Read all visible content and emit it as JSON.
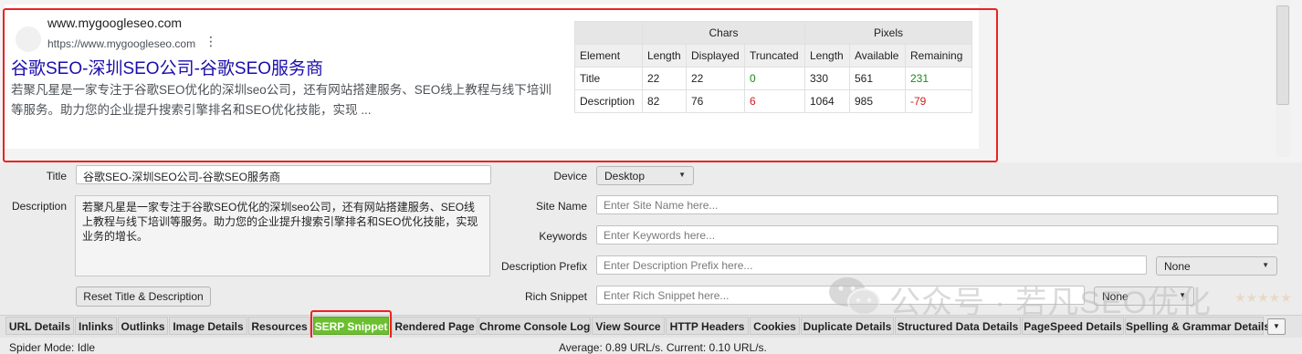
{
  "preview": {
    "site_name": "www.mygoogleseo.com",
    "site_url": "https://www.mygoogleseo.com",
    "kebab": "⋮",
    "title": "谷歌SEO-深圳SEO公司-谷歌SEO服务商",
    "description": "若聚凡星是一家专注于谷歌SEO优化的深圳seo公司，还有网站搭建服务、SEO线上教程与线下培训等服务。助力您的企业提升搜索引擎排名和SEO优化技能，实现 ..."
  },
  "stats": {
    "group_chars": "Chars",
    "group_pixels": "Pixels",
    "headers": [
      "Element",
      "Length",
      "Displayed",
      "Truncated",
      "Length",
      "Available",
      "Remaining"
    ],
    "rows": [
      {
        "element": "Title",
        "chars_length": "22",
        "displayed": "22",
        "truncated": "0",
        "px_length": "330",
        "available": "561",
        "remaining": "231"
      },
      {
        "element": "Description",
        "chars_length": "82",
        "displayed": "76",
        "truncated": "6",
        "px_length": "1064",
        "available": "985",
        "remaining": "-79"
      }
    ],
    "colors": {
      "positive": "#1a8a1a",
      "negative": "#d02020"
    }
  },
  "form": {
    "title_label": "Title",
    "title_value": "谷歌SEO-深圳SEO公司-谷歌SEO服务商",
    "description_label": "Description",
    "description_value": "若聚凡星是一家专注于谷歌SEO优化的深圳seo公司，还有网站搭建服务、SEO线上教程与线下培训等服务。助力您的企业提升搜索引擎排名和SEO优化技能，实现业务的增长。",
    "reset_button": "Reset Title & Description",
    "device_label": "Device",
    "device_value": "Desktop",
    "site_name_label": "Site Name",
    "site_name_placeholder": "Enter Site Name here...",
    "keywords_label": "Keywords",
    "keywords_placeholder": "Enter Keywords here...",
    "desc_prefix_label": "Description Prefix",
    "desc_prefix_placeholder": "Enter Description Prefix here...",
    "desc_prefix_select": "None",
    "rich_snippet_label": "Rich Snippet",
    "rich_snippet_placeholder": "Enter Rich Snippet here...",
    "rich_snippet_select": "None"
  },
  "tabs": [
    "URL Details",
    "Inlinks",
    "Outlinks",
    "Image Details",
    "Resources",
    "SERP Snippet",
    "Rendered Page",
    "Chrome Console Log",
    "View Source",
    "HTTP Headers",
    "Cookies",
    "Duplicate Details",
    "Structured Data Details",
    "PageSpeed Details",
    "Spelling & Grammar Details"
  ],
  "active_tab": "SERP Snippet",
  "status": {
    "mode": "Spider Mode: Idle",
    "speed": "Average: 0.89 URL/s. Current: 0.10 URL/s."
  },
  "watermark": {
    "text": "公众号 · 若凡SEO优化",
    "stars": "★★★★★"
  },
  "theme": {
    "accent": "#6cbf30",
    "highlight": "#e22222",
    "link": "#1a0dab"
  }
}
